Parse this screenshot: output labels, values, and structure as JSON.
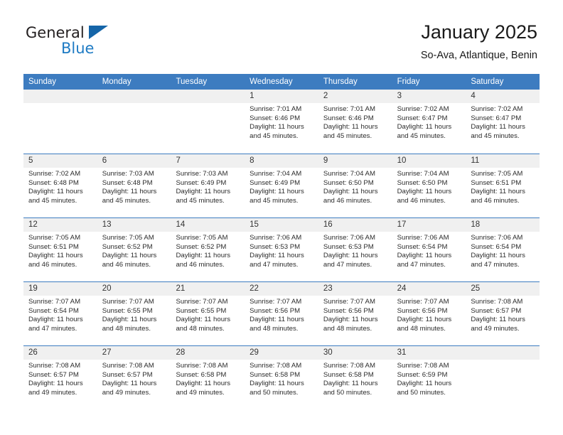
{
  "brand": {
    "name_part1": "General",
    "name_part2": "Blue",
    "logo_icon": "triangle-logo-icon"
  },
  "header": {
    "title": "January 2025",
    "subtitle": "So-Ava, Atlantique, Benin"
  },
  "theme": {
    "header_blue": "#3d7cc0",
    "brand_blue": "#1e7bc4",
    "daynum_band": "#f0f0f0"
  },
  "weekdays": [
    "Sunday",
    "Monday",
    "Tuesday",
    "Wednesday",
    "Thursday",
    "Friday",
    "Saturday"
  ],
  "weeks": [
    [
      {
        "day": "",
        "lines": []
      },
      {
        "day": "",
        "lines": []
      },
      {
        "day": "",
        "lines": []
      },
      {
        "day": "1",
        "lines": [
          "Sunrise: 7:01 AM",
          "Sunset: 6:46 PM",
          "Daylight: 11 hours",
          "and 45 minutes."
        ]
      },
      {
        "day": "2",
        "lines": [
          "Sunrise: 7:01 AM",
          "Sunset: 6:46 PM",
          "Daylight: 11 hours",
          "and 45 minutes."
        ]
      },
      {
        "day": "3",
        "lines": [
          "Sunrise: 7:02 AM",
          "Sunset: 6:47 PM",
          "Daylight: 11 hours",
          "and 45 minutes."
        ]
      },
      {
        "day": "4",
        "lines": [
          "Sunrise: 7:02 AM",
          "Sunset: 6:47 PM",
          "Daylight: 11 hours",
          "and 45 minutes."
        ]
      }
    ],
    [
      {
        "day": "5",
        "lines": [
          "Sunrise: 7:02 AM",
          "Sunset: 6:48 PM",
          "Daylight: 11 hours",
          "and 45 minutes."
        ]
      },
      {
        "day": "6",
        "lines": [
          "Sunrise: 7:03 AM",
          "Sunset: 6:48 PM",
          "Daylight: 11 hours",
          "and 45 minutes."
        ]
      },
      {
        "day": "7",
        "lines": [
          "Sunrise: 7:03 AM",
          "Sunset: 6:49 PM",
          "Daylight: 11 hours",
          "and 45 minutes."
        ]
      },
      {
        "day": "8",
        "lines": [
          "Sunrise: 7:04 AM",
          "Sunset: 6:49 PM",
          "Daylight: 11 hours",
          "and 45 minutes."
        ]
      },
      {
        "day": "9",
        "lines": [
          "Sunrise: 7:04 AM",
          "Sunset: 6:50 PM",
          "Daylight: 11 hours",
          "and 46 minutes."
        ]
      },
      {
        "day": "10",
        "lines": [
          "Sunrise: 7:04 AM",
          "Sunset: 6:50 PM",
          "Daylight: 11 hours",
          "and 46 minutes."
        ]
      },
      {
        "day": "11",
        "lines": [
          "Sunrise: 7:05 AM",
          "Sunset: 6:51 PM",
          "Daylight: 11 hours",
          "and 46 minutes."
        ]
      }
    ],
    [
      {
        "day": "12",
        "lines": [
          "Sunrise: 7:05 AM",
          "Sunset: 6:51 PM",
          "Daylight: 11 hours",
          "and 46 minutes."
        ]
      },
      {
        "day": "13",
        "lines": [
          "Sunrise: 7:05 AM",
          "Sunset: 6:52 PM",
          "Daylight: 11 hours",
          "and 46 minutes."
        ]
      },
      {
        "day": "14",
        "lines": [
          "Sunrise: 7:05 AM",
          "Sunset: 6:52 PM",
          "Daylight: 11 hours",
          "and 46 minutes."
        ]
      },
      {
        "day": "15",
        "lines": [
          "Sunrise: 7:06 AM",
          "Sunset: 6:53 PM",
          "Daylight: 11 hours",
          "and 47 minutes."
        ]
      },
      {
        "day": "16",
        "lines": [
          "Sunrise: 7:06 AM",
          "Sunset: 6:53 PM",
          "Daylight: 11 hours",
          "and 47 minutes."
        ]
      },
      {
        "day": "17",
        "lines": [
          "Sunrise: 7:06 AM",
          "Sunset: 6:54 PM",
          "Daylight: 11 hours",
          "and 47 minutes."
        ]
      },
      {
        "day": "18",
        "lines": [
          "Sunrise: 7:06 AM",
          "Sunset: 6:54 PM",
          "Daylight: 11 hours",
          "and 47 minutes."
        ]
      }
    ],
    [
      {
        "day": "19",
        "lines": [
          "Sunrise: 7:07 AM",
          "Sunset: 6:54 PM",
          "Daylight: 11 hours",
          "and 47 minutes."
        ]
      },
      {
        "day": "20",
        "lines": [
          "Sunrise: 7:07 AM",
          "Sunset: 6:55 PM",
          "Daylight: 11 hours",
          "and 48 minutes."
        ]
      },
      {
        "day": "21",
        "lines": [
          "Sunrise: 7:07 AM",
          "Sunset: 6:55 PM",
          "Daylight: 11 hours",
          "and 48 minutes."
        ]
      },
      {
        "day": "22",
        "lines": [
          "Sunrise: 7:07 AM",
          "Sunset: 6:56 PM",
          "Daylight: 11 hours",
          "and 48 minutes."
        ]
      },
      {
        "day": "23",
        "lines": [
          "Sunrise: 7:07 AM",
          "Sunset: 6:56 PM",
          "Daylight: 11 hours",
          "and 48 minutes."
        ]
      },
      {
        "day": "24",
        "lines": [
          "Sunrise: 7:07 AM",
          "Sunset: 6:56 PM",
          "Daylight: 11 hours",
          "and 48 minutes."
        ]
      },
      {
        "day": "25",
        "lines": [
          "Sunrise: 7:08 AM",
          "Sunset: 6:57 PM",
          "Daylight: 11 hours",
          "and 49 minutes."
        ]
      }
    ],
    [
      {
        "day": "26",
        "lines": [
          "Sunrise: 7:08 AM",
          "Sunset: 6:57 PM",
          "Daylight: 11 hours",
          "and 49 minutes."
        ]
      },
      {
        "day": "27",
        "lines": [
          "Sunrise: 7:08 AM",
          "Sunset: 6:57 PM",
          "Daylight: 11 hours",
          "and 49 minutes."
        ]
      },
      {
        "day": "28",
        "lines": [
          "Sunrise: 7:08 AM",
          "Sunset: 6:58 PM",
          "Daylight: 11 hours",
          "and 49 minutes."
        ]
      },
      {
        "day": "29",
        "lines": [
          "Sunrise: 7:08 AM",
          "Sunset: 6:58 PM",
          "Daylight: 11 hours",
          "and 50 minutes."
        ]
      },
      {
        "day": "30",
        "lines": [
          "Sunrise: 7:08 AM",
          "Sunset: 6:58 PM",
          "Daylight: 11 hours",
          "and 50 minutes."
        ]
      },
      {
        "day": "31",
        "lines": [
          "Sunrise: 7:08 AM",
          "Sunset: 6:59 PM",
          "Daylight: 11 hours",
          "and 50 minutes."
        ]
      },
      {
        "day": "",
        "lines": []
      }
    ]
  ]
}
